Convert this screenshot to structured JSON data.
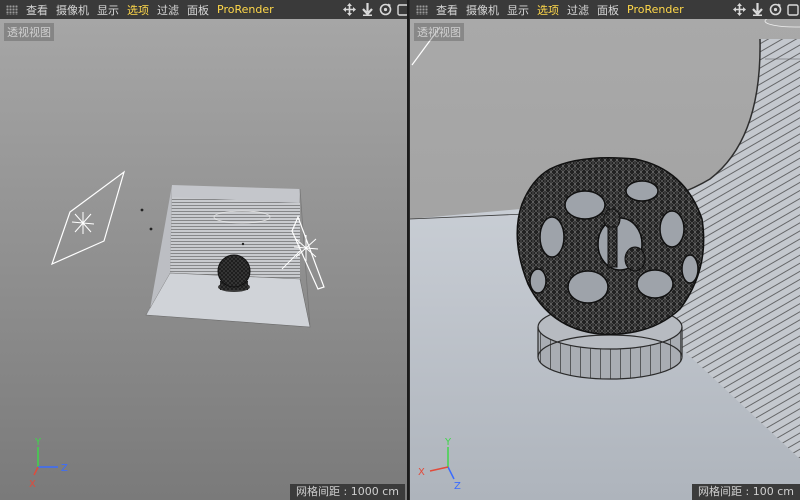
{
  "menu": {
    "items": [
      "查看",
      "摄像机",
      "显示",
      "选项",
      "过滤",
      "面板",
      "ProRender"
    ],
    "active": "选项"
  },
  "viewports": [
    {
      "name": "left",
      "view_label": "透视视图",
      "grid_spacing": "网格间距 : 1000 cm",
      "axes": {
        "y": "Y",
        "z": "Z",
        "x": "X"
      }
    },
    {
      "name": "right",
      "view_label": "透视视图",
      "grid_spacing": "网格间距 : 100 cm",
      "axes": {
        "y": "Y",
        "z": "Z",
        "x": "X"
      }
    }
  ],
  "nav_icons": [
    "move-icon",
    "down-arrow-icon",
    "rotate-icon",
    "maximize-icon"
  ],
  "colors": {
    "menubar_bg": "#3a3a3a",
    "menu_text": "#d8d8d8",
    "menu_active": "#ffd84a",
    "axis_y": "#3fd64a",
    "axis_z": "#3a6cff",
    "axis_x": "#e24a3a"
  }
}
